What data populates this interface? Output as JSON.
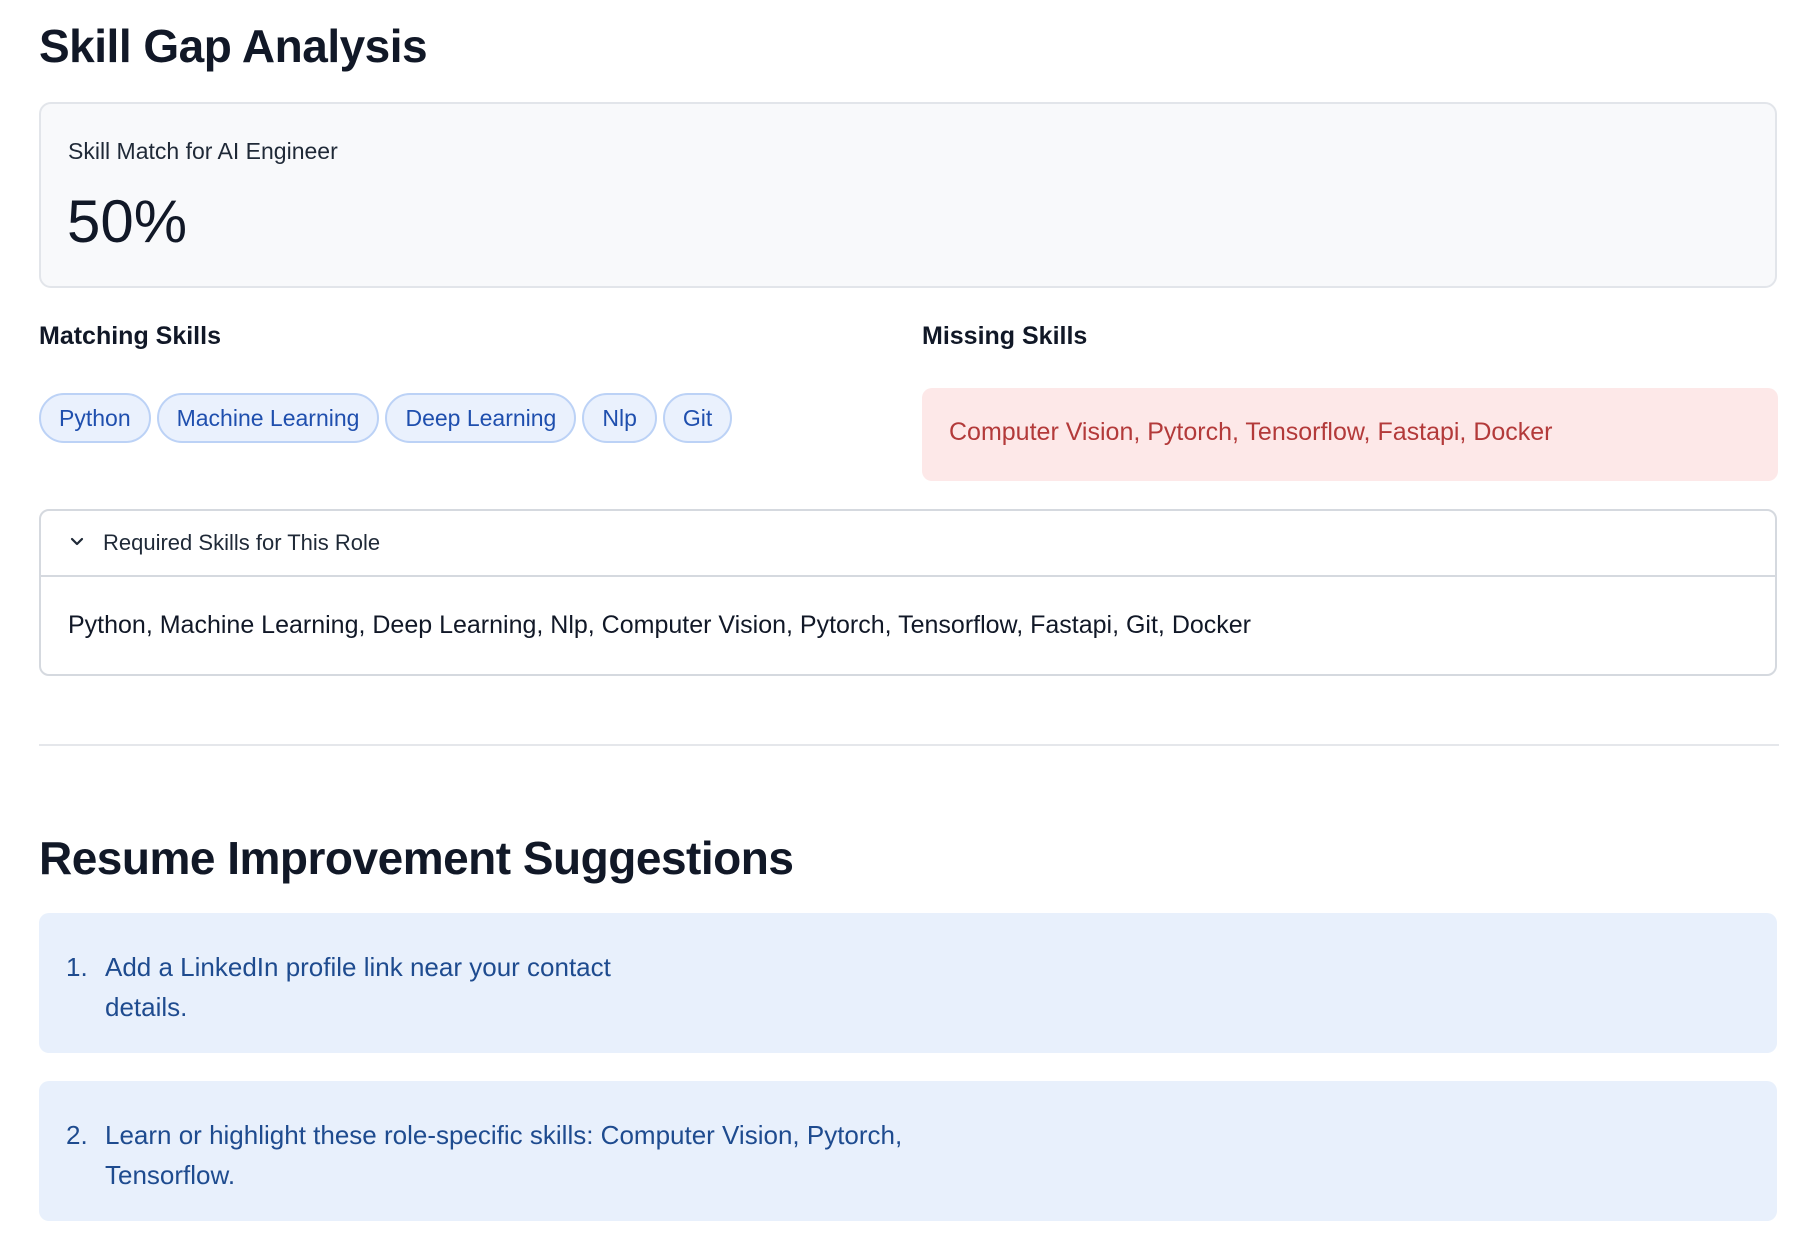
{
  "skill_gap": {
    "title": "Skill Gap Analysis",
    "metric_label": "Skill Match for AI Engineer",
    "metric_value": "50%",
    "matching_heading": "Matching Skills",
    "matching_skills": [
      "Python",
      "Machine Learning",
      "Deep Learning",
      "Nlp",
      "Git"
    ],
    "missing_heading": "Missing Skills",
    "missing_skills_text": "Computer Vision, Pytorch, Tensorflow, Fastapi, Docker",
    "required": {
      "header": "Required Skills for This Role",
      "body": "Python, Machine Learning, Deep Learning, Nlp, Computer Vision, Pytorch, Tensorflow, Fastapi, Git, Docker"
    }
  },
  "suggestions": {
    "title": "Resume Improvement Suggestions",
    "items": [
      {
        "num": "1.",
        "text": "Add a LinkedIn profile link near your contact details."
      },
      {
        "num": "2.",
        "text": "Learn or highlight these role-specific skills: Computer Vision, Pytorch, Tensorflow."
      }
    ]
  },
  "colors": {
    "chip_bg": "#eaf1fd",
    "chip_text": "#1f4fae",
    "missing_bg": "#fde8e8",
    "missing_text": "#b33a3a",
    "suggestion_bg": "#e8f0fc"
  }
}
